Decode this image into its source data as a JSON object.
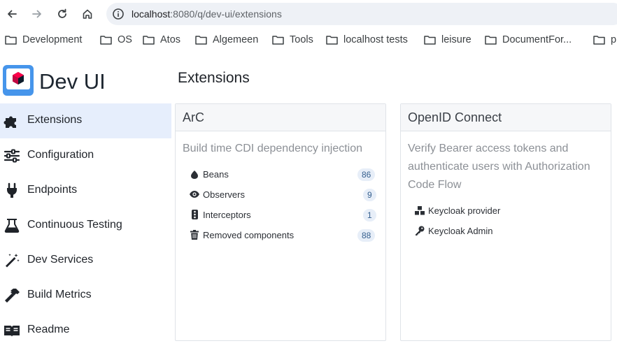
{
  "browser": {
    "url_host": "localhost",
    "url_rest": ":8080/q/dev-ui/extensions",
    "bookmarks": [
      {
        "label": "Development"
      },
      {
        "label": "OS"
      },
      {
        "label": "Atos"
      },
      {
        "label": "Algemeen"
      },
      {
        "label": "Tools"
      },
      {
        "label": "localhost tests"
      },
      {
        "label": "leisure"
      },
      {
        "label": "DocumentFor..."
      },
      {
        "label": "p"
      }
    ]
  },
  "app": {
    "brand": "Dev UI",
    "page_title": "Extensions",
    "accent_color": "#e6eefc",
    "menu": [
      {
        "label": "Extensions",
        "icon": "puzzle-icon",
        "active": true
      },
      {
        "label": "Configuration",
        "icon": "sliders-icon"
      },
      {
        "label": "Endpoints",
        "icon": "plug-icon"
      },
      {
        "label": "Continuous Testing",
        "icon": "flask-icon"
      },
      {
        "label": "Dev Services",
        "icon": "magic-wand-icon"
      },
      {
        "label": "Build Metrics",
        "icon": "hammer-icon"
      },
      {
        "label": "Readme",
        "icon": "book-icon"
      }
    ]
  },
  "cards": [
    {
      "title": "ArC",
      "description": "Build time CDI dependency injection",
      "links": [
        {
          "label": "Beans",
          "icon": "seed-icon",
          "count": "86"
        },
        {
          "label": "Observers",
          "icon": "eye-icon",
          "count": "9"
        },
        {
          "label": "Interceptors",
          "icon": "traffic-light-icon",
          "count": "1"
        },
        {
          "label": "Removed components",
          "icon": "trash-icon",
          "count": "88"
        }
      ]
    },
    {
      "title": "OpenID Connect",
      "description_lines": [
        "Verify Bearer access tokens and",
        "authenticate users with Authorization",
        "Code Flow"
      ],
      "links": [
        {
          "label": "Keycloak provider",
          "icon": "cubes-icon"
        },
        {
          "label": "Keycloak Admin",
          "icon": "key-icon"
        }
      ]
    }
  ]
}
